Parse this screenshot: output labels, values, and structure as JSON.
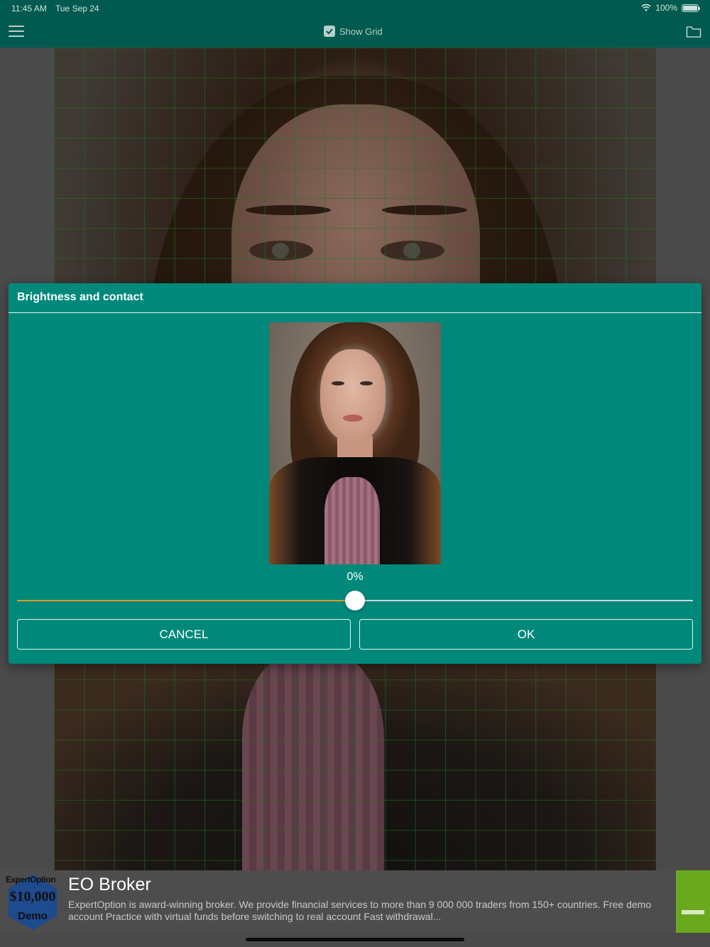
{
  "status_bar": {
    "time": "11:45 AM",
    "date": "Tue Sep 24",
    "battery": "100%"
  },
  "toolbar": {
    "show_grid_label": "Show Grid",
    "show_grid_checked": true
  },
  "dialog": {
    "title": "Brightness and contact",
    "slider_value_label": "0%",
    "slider_fraction": 0.5,
    "cancel_label": "CANCEL",
    "ok_label": "OK"
  },
  "ad": {
    "logo_brand": "ExpertOption",
    "logo_amount": "$10,000",
    "logo_demo": "Demo",
    "title": "EO Broker",
    "description": "ExpertOption is award-winning broker. We provide financial services to more than 9 000 000 traders from 150+ countries. Free demo account Practice with virtual funds before switching to real account Fast withdrawal..."
  },
  "colors": {
    "toolbar": "#005a4f",
    "dialog": "#00897b",
    "slider_fill": "#e09a1e",
    "ad_cta": "#6aa81e"
  }
}
